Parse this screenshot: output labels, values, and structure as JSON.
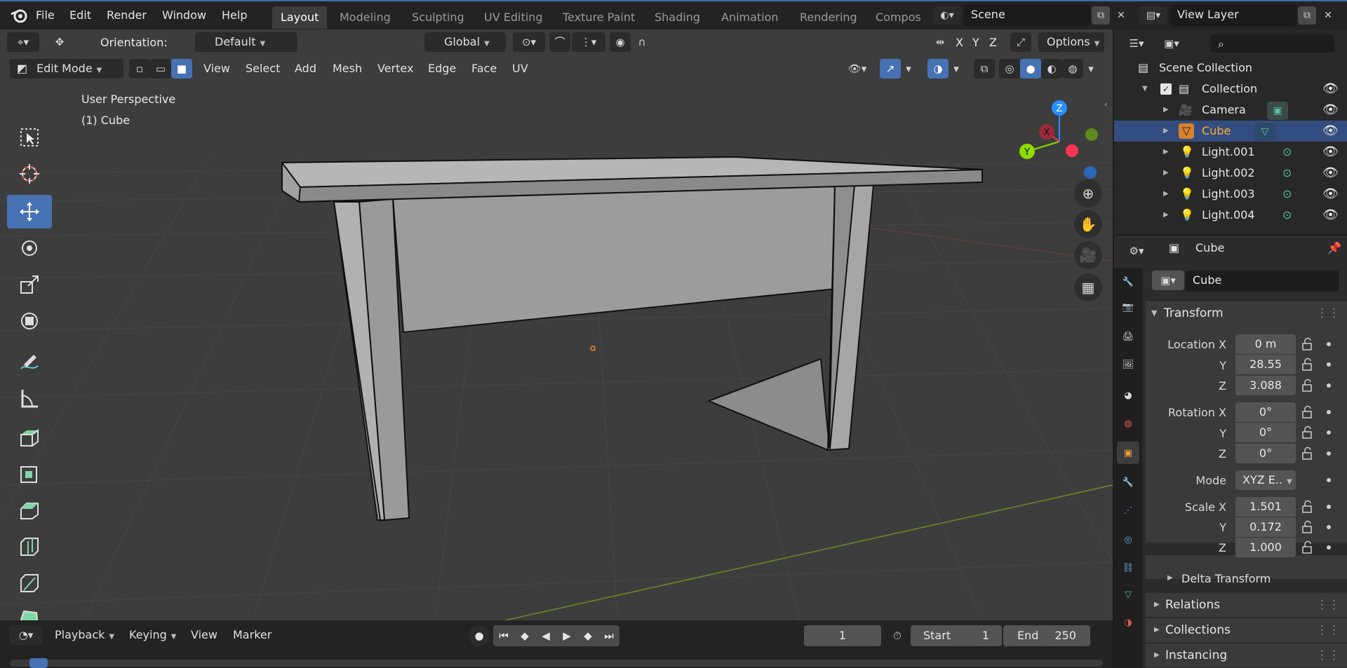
{
  "menu": {
    "items": [
      "File",
      "Edit",
      "Render",
      "Window",
      "Help"
    ]
  },
  "workspaces": {
    "tabs": [
      "Layout",
      "Modeling",
      "Sculpting",
      "UV Editing",
      "Texture Paint",
      "Shading",
      "Animation",
      "Rendering",
      "Compos"
    ],
    "active": "Layout"
  },
  "scene": {
    "name": "Scene",
    "view_layer": "View Layer"
  },
  "tool_header": {
    "orientation_label": "Orientation:",
    "orientation_value": "Default",
    "transform_orientation": "Global",
    "axes": [
      "X",
      "Y",
      "Z"
    ],
    "options_label": "Options"
  },
  "viewport_header": {
    "mode": "Edit Mode",
    "menus": [
      "View",
      "Select",
      "Add",
      "Mesh",
      "Vertex",
      "Edge",
      "Face",
      "UV"
    ]
  },
  "viewport": {
    "perspective_label": "User Perspective",
    "object_label": "(1) Cube",
    "gizmo_axes": {
      "z": "Z",
      "y": "Y",
      "x": "X"
    }
  },
  "toolbar": {
    "tools": [
      "select-box-icon",
      "cursor-icon",
      "move-icon",
      "rotate-icon",
      "scale-icon",
      "transform-icon",
      "annotate-icon",
      "measure-icon",
      "extrude-icon",
      "inset-icon",
      "bevel-icon",
      "loop-cut-icon",
      "knife-icon",
      "poly-build-icon"
    ],
    "active_tool": "move-icon"
  },
  "timeline": {
    "menus": [
      "Playback",
      "Keying",
      "View",
      "Marker"
    ],
    "current_frame": "1",
    "start_label": "Start",
    "start_value": "1",
    "end_label": "End",
    "end_value": "250"
  },
  "outliner": {
    "scene_collection": "Scene Collection",
    "collection": "Collection",
    "items": [
      {
        "name": "Camera",
        "selected": false
      },
      {
        "name": "Cube",
        "selected": true
      },
      {
        "name": "Light.001",
        "selected": false
      },
      {
        "name": "Light.002",
        "selected": false
      },
      {
        "name": "Light.003",
        "selected": false
      },
      {
        "name": "Light.004",
        "selected": false
      }
    ]
  },
  "properties": {
    "header_object": "Cube",
    "object_name": "Cube",
    "transform_title": "Transform",
    "location_label": "Location X",
    "location": {
      "x": "0 m",
      "y": "28.55",
      "z": "3.088"
    },
    "rotation_label": "Rotation X",
    "rotation": {
      "x": "0°",
      "y": "0°",
      "z": "0°"
    },
    "mode_label": "Mode",
    "mode_value": "XYZ E..",
    "scale_label": "Scale X",
    "scale": {
      "x": "1.501",
      "y": "0.172",
      "z": "1.000"
    },
    "axis_y": "Y",
    "axis_z": "Z",
    "sections": [
      "Delta Transform",
      "Relations",
      "Collections",
      "Instancing"
    ]
  },
  "colors": {
    "accent": "#4772b3",
    "selected_row": "#334d80",
    "selected_text": "#ffaf29",
    "x_axis": "#ff3352",
    "y_axis": "#8bdc00",
    "z_axis": "#2890ff"
  }
}
